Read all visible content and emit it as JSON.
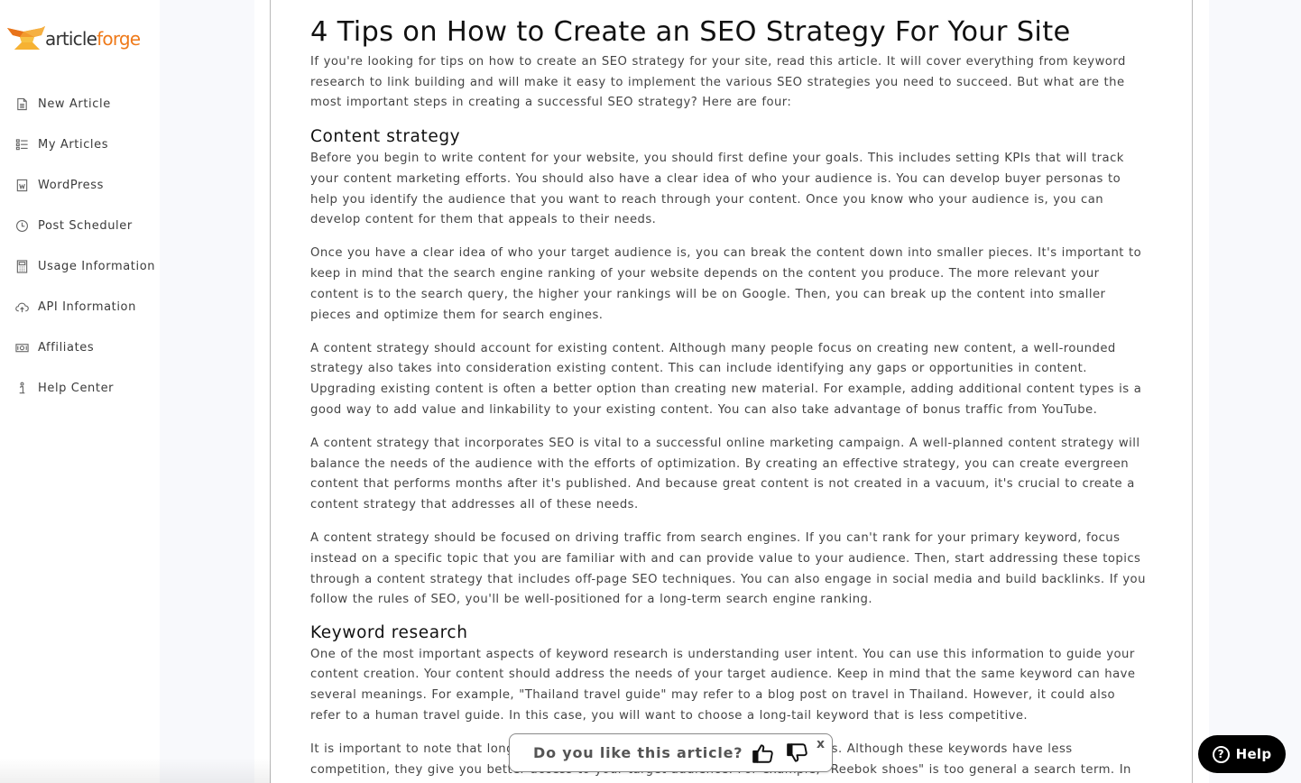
{
  "brand": {
    "name_part1": "article",
    "name_part2": "forge",
    "accent_color": "#ef7a1a"
  },
  "sidebar": {
    "items": [
      {
        "label": "New Article",
        "icon": "document-icon"
      },
      {
        "label": "My Articles",
        "icon": "list-icon"
      },
      {
        "label": "WordPress",
        "icon": "wordpress-icon"
      },
      {
        "label": "Post Scheduler",
        "icon": "clock-icon"
      },
      {
        "label": "Usage Information",
        "icon": "calculator-icon"
      },
      {
        "label": "API Information",
        "icon": "cloud-upload-icon"
      },
      {
        "label": "Affiliates",
        "icon": "money-icon"
      },
      {
        "label": "Help Center",
        "icon": "info-icon"
      }
    ]
  },
  "article": {
    "title": "4 Tips on How to Create an SEO Strategy For Your Site",
    "intro": "If you're looking for tips on how to create an SEO strategy for your site, read this article. It will cover everything from keyword research to link building and will make it easy to implement the various SEO strategies you need to succeed. But what are the most important steps in creating a successful SEO strategy? Here are four:",
    "sections": [
      {
        "heading": "Content strategy",
        "paragraphs": [
          "Before you begin to write content for your website, you should first define your goals. This includes setting KPIs that will track your content marketing efforts. You should also have a clear idea of who your audience is. You can develop buyer personas to help you identify the audience that you want to reach through your content. Once you know who your audience is, you can develop content for them that appeals to their needs.",
          "Once you have a clear idea of who your target audience is, you can break the content down into smaller pieces. It's important to keep in mind that the search engine ranking of your website depends on the content you produce. The more relevant your content is to the search query, the higher your rankings will be on Google. Then, you can break up the content into smaller pieces and optimize them for search engines.",
          "A content strategy should account for existing content. Although many people focus on creating new content, a well-rounded strategy also takes into consideration existing content. This can include identifying any gaps or opportunities in content. Upgrading existing content is often a better option than creating new material. For example, adding additional content types is a good way to add value and linkability to your existing content. You can also take advantage of bonus traffic from YouTube.",
          "A content strategy that incorporates SEO is vital to a successful online marketing campaign. A well-planned content strategy will balance the needs of the audience with the efforts of optimization. By creating an effective strategy, you can create evergreen content that performs months after it's published. And because great content is not created in a vacuum, it's crucial to create a content strategy that addresses all of these needs.",
          "A content strategy should be focused on driving traffic from search engines. If you can't rank for your primary keyword, focus instead on a specific topic that you are familiar with and can provide value to your audience. Then, start addressing these topics through a content strategy that includes off-page SEO techniques. You can also engage in social media and build backlinks. If you follow the rules of SEO, you'll be well-positioned for a long-term search engine ranking."
        ]
      },
      {
        "heading": "Keyword research",
        "paragraphs": [
          "One of the most important aspects of keyword research is understanding user intent. You can use this information to guide your content creation. Your content should address the needs of your target audience. Keep in mind that the same keyword can have several meanings. For example, \"Thailand travel guide\" may refer to a blog post on travel in Thailand. However, it could also refer to a human travel guide. In this case, you will want to choose a long-tail keyword that is less competitive.",
          "It is important to note that long-tail keywords are more specific than generic ones. Although these keywords have less competition, they give you better access to your target audience. For example, \"Reebok shoes\" is too general a search term. In contrast, \"Reebok"
        ]
      }
    ]
  },
  "feedback": {
    "question": "Do you like this article?",
    "like_icon": "thumbs-up-icon",
    "dislike_icon": "thumbs-down-icon",
    "close_label": "x"
  },
  "help_button": {
    "label": "Help",
    "icon_glyph": "?"
  }
}
